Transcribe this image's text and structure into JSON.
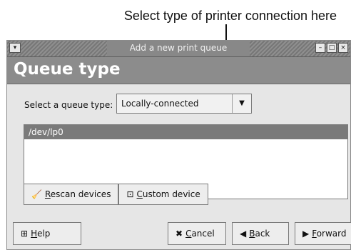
{
  "callout": {
    "text": "Select type of printer connection here"
  },
  "window": {
    "title": "Add a new print queue",
    "menu_icon": "chevron-down-icon",
    "controls": [
      "minimize-icon",
      "maximize-icon",
      "close-icon"
    ]
  },
  "header": {
    "title": "Queue type"
  },
  "queue_type": {
    "label": "Select a queue type:",
    "selected": "Locally-connected",
    "arrow_icon": "chevron-down-icon"
  },
  "devices": {
    "items": [
      "/dev/lp0"
    ],
    "selected_index": 0
  },
  "list_buttons": {
    "rescan": {
      "prefix": "R",
      "rest": "escan devices",
      "icon": "broom-icon"
    },
    "custom": {
      "prefix": "C",
      "rest": "ustom device",
      "icon": "device-icon"
    }
  },
  "footer": {
    "help": {
      "prefix": "H",
      "rest": "elp",
      "icon": "help-icon"
    },
    "cancel": {
      "prefix": "C",
      "rest": "ancel",
      "icon": "cancel-icon"
    },
    "back": {
      "prefix": "B",
      "rest": "ack",
      "icon": "back-arrow-icon"
    },
    "forward": {
      "prefix": "F",
      "rest": "orward",
      "icon": "forward-arrow-icon"
    }
  },
  "colors": {
    "header_bg": "#8c8c8c",
    "selection_bg": "#7a7a7a",
    "window_bg": "#e6e6e6"
  }
}
